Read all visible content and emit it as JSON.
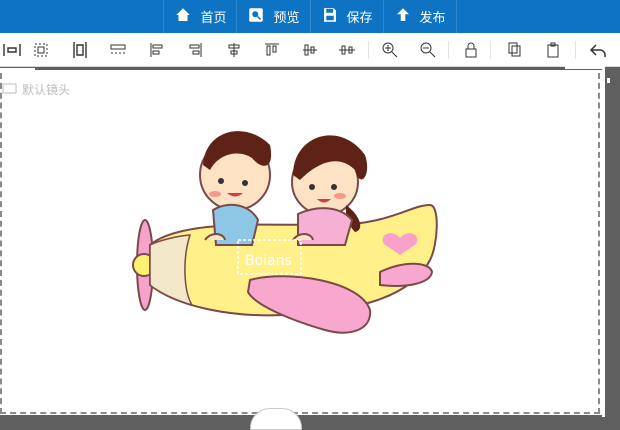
{
  "topbar": {
    "buttons": [
      {
        "label": "首页",
        "icon": "home-icon"
      },
      {
        "label": "预览",
        "icon": "preview-icon"
      },
      {
        "label": "保存",
        "icon": "save-icon"
      },
      {
        "label": "发布",
        "icon": "publish-icon"
      }
    ]
  },
  "toolbar": {
    "tools": [
      "align-horizontal-distribute-icon",
      "align-center-box-icon",
      "align-vertical-distribute-icon",
      "align-width-icon",
      "align-left-icon",
      "align-right-icon",
      "align-center-icon",
      "align-top-icon",
      "align-middle-icon",
      "zoom-in-icon",
      "zoom-out-icon",
      "lock-icon",
      "copy-icon",
      "paste-icon",
      "undo-icon"
    ]
  },
  "canvas": {
    "lens_label": "默认镜头",
    "image_text": "Boians"
  },
  "colors": {
    "topbar": "#0f73c4",
    "workspace": "#5f5f5f",
    "plane_body": "#fff08a",
    "plane_wing": "#f8a8cf"
  }
}
